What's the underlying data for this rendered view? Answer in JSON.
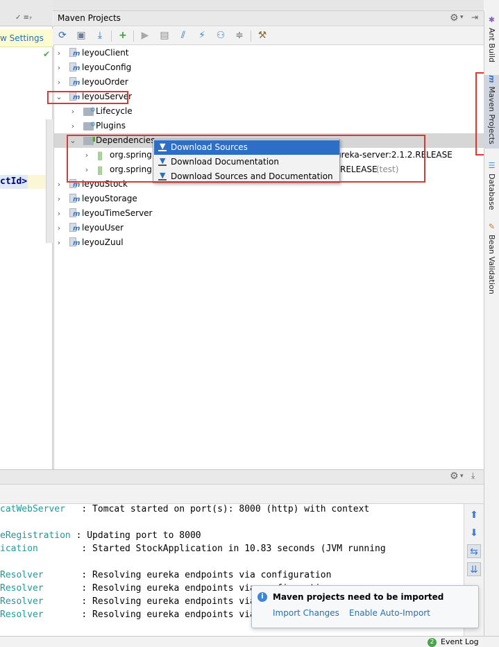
{
  "left_editor": {
    "banner_text": "w Settings",
    "artifact_fragment": "ctId>"
  },
  "maven": {
    "title": "Maven Projects",
    "toolbar_icons": [
      "reimport-icon",
      "generate-sources-icon",
      "download-icon",
      "add-icon",
      "run-icon",
      "execute-goal-icon",
      "toggle-offline-icon",
      "skip-tests-icon",
      "show-dependencies-icon",
      "collapse-all-icon",
      "settings-icon"
    ],
    "projects": [
      {
        "label": "leyouClient"
      },
      {
        "label": "leyouConfig"
      },
      {
        "label": "leyouOrder"
      },
      {
        "label": "leyouServer"
      },
      {
        "label": "leyouStock"
      },
      {
        "label": "leyouStorage"
      },
      {
        "label": "leyouTimeServer"
      },
      {
        "label": "leyouUser"
      },
      {
        "label": "leyouZuul"
      }
    ],
    "children": {
      "lifecycle": "Lifecycle",
      "plugins": "Plugins",
      "dependencies": "Dependencies"
    },
    "deps": [
      {
        "left": "org.spring",
        "right": "ureka-server:2.1.2.RELEASE",
        "scope": ""
      },
      {
        "left": "org.spring",
        "right": "RELEASE",
        "scope": "(test)"
      }
    ]
  },
  "context_menu": {
    "items": [
      {
        "label": "Download Sources",
        "selected": true
      },
      {
        "label": "Download Documentation",
        "selected": false
      },
      {
        "label": "Download Sources and Documentation",
        "selected": false
      }
    ]
  },
  "right_tabs": {
    "ant_build": "Ant Build",
    "maven_projects": "Maven Projects",
    "database": "Database",
    "bean_validation": "Bean Validation"
  },
  "console": {
    "lines": [
      {
        "src": "catWebServer   ",
        "msg": ": Tomcat started on port(s): 8000 (http) with context"
      },
      {
        "src": "",
        "msg": ""
      },
      {
        "src": "eRegistration ",
        "msg": ": Updating port to 8000"
      },
      {
        "src": "ication        ",
        "msg": ": Started StockApplication in 10.83 seconds (JVM running"
      },
      {
        "src": "",
        "msg": ""
      },
      {
        "src": "Resolver       ",
        "msg": ": Resolving eureka endpoints via configuration"
      },
      {
        "src": "Resolver       ",
        "msg": ": Resolving eureka endpoints via configuration"
      },
      {
        "src": "Resolver       ",
        "msg": ": Resolving eureka endpoints via configuration"
      },
      {
        "src": "Resolver       ",
        "msg": ": Resolving eureka endpoints via configuration"
      }
    ]
  },
  "notification": {
    "title": "Maven projects need to be imported",
    "import_changes": "Import Changes",
    "enable_auto_import": "Enable Auto-Import"
  },
  "status_bar": {
    "event_count": "2",
    "event_log": "Event Log"
  },
  "colors": {
    "accent": "#2d6fc6",
    "annotation": "#e0362f",
    "console_source": "#1a9a9a",
    "link": "#2470b3"
  }
}
